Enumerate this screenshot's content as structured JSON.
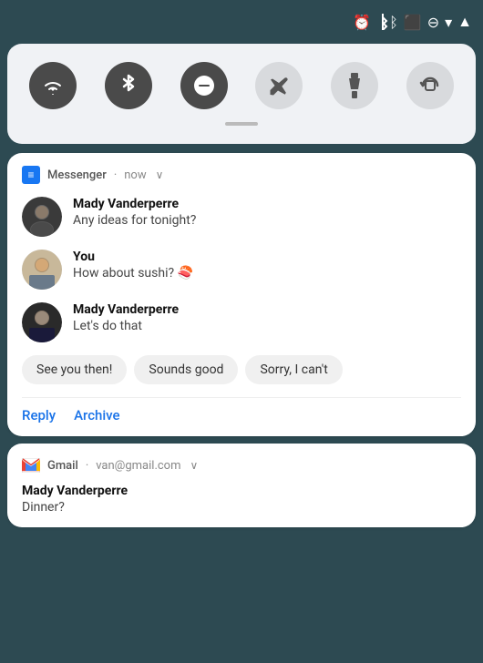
{
  "statusBar": {
    "icons": [
      "alarm",
      "bluetooth",
      "cast",
      "dnd",
      "wifi",
      "signal"
    ]
  },
  "quickSettings": {
    "icons": [
      {
        "name": "wifi",
        "symbol": "▾",
        "active": true
      },
      {
        "name": "bluetooth",
        "symbol": "⚡",
        "active": true
      },
      {
        "name": "dnd",
        "symbol": "–",
        "active": true
      },
      {
        "name": "airplane",
        "symbol": "✈",
        "active": false
      },
      {
        "name": "flashlight",
        "symbol": "🔦",
        "active": false
      },
      {
        "name": "rotate",
        "symbol": "⟳",
        "active": false
      }
    ]
  },
  "notifications": {
    "messenger": {
      "appName": "Messenger",
      "time": "now",
      "messages": [
        {
          "sender": "Mady Vanderperre",
          "text": "Any ideas for tonight?",
          "isUser": false
        },
        {
          "sender": "You",
          "text": "How about sushi? 🍣",
          "isUser": true
        },
        {
          "sender": "Mady Vanderperre",
          "text": "Let's do that",
          "isUser": false
        }
      ],
      "quickReplies": [
        "See you then!",
        "Sounds good",
        "Sorry, I can't"
      ],
      "actions": [
        "Reply",
        "Archive"
      ]
    },
    "gmail": {
      "appName": "Gmail",
      "account": "van@gmail.com",
      "sender": "Mady Vanderperre",
      "subject": "Dinner?"
    }
  }
}
